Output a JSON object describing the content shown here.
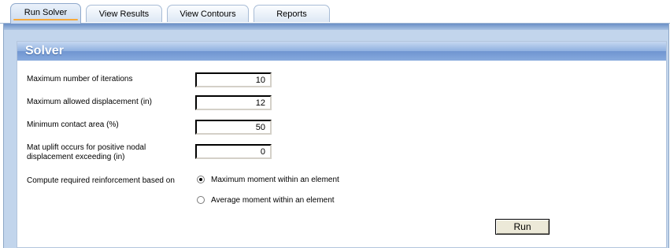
{
  "tabs": [
    {
      "label": "Run Solver",
      "active": true
    },
    {
      "label": "View Results",
      "active": false
    },
    {
      "label": "View Contours",
      "active": false
    },
    {
      "label": "Reports",
      "active": false
    }
  ],
  "solver": {
    "title": "Solver",
    "fields": [
      {
        "label": "Maximum number of iterations",
        "value": "10"
      },
      {
        "label": "Maximum allowed displacement (in)",
        "value": "12"
      },
      {
        "label": "Minimum contact area (%)",
        "value": "50"
      },
      {
        "label_line1": "Mat uplift occurs for positive nodal",
        "label_line2": "displacement exceeding (in)",
        "value": "0"
      }
    ],
    "reinforcement": {
      "label": "Compute required reinforcement based on",
      "options": [
        {
          "label": "Maximum moment within an element",
          "selected": true
        },
        {
          "label": "Average moment within an element",
          "selected": false
        }
      ]
    },
    "run_label": "Run"
  },
  "colors": {
    "panel_bg": "#c2d5ec",
    "header_blue": "#7a9fd6",
    "tab_accent": "#f6a93b"
  }
}
